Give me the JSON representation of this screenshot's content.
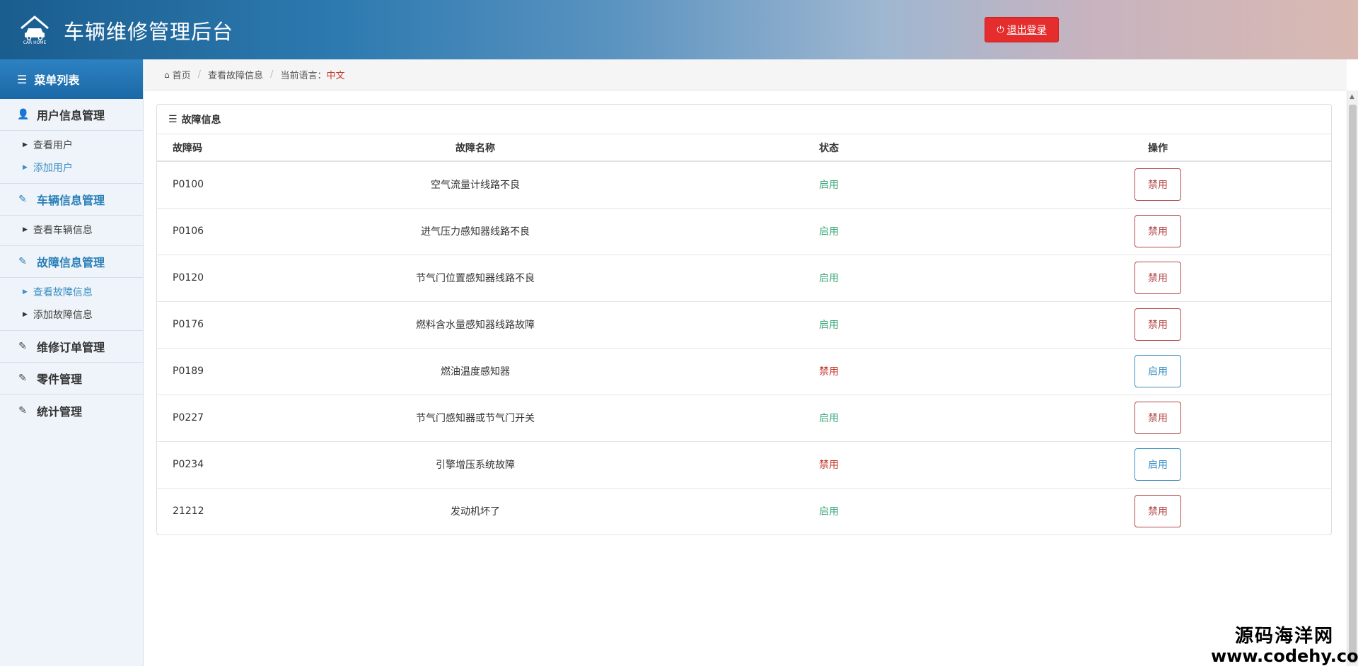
{
  "header": {
    "app_title": "车辆维修管理后台",
    "logout_label": "退出登录",
    "logo_icon": "car-home-icon",
    "logo_text": "CAR HOME"
  },
  "sidebar": {
    "menu_title": "菜单列表",
    "groups": [
      {
        "title": "用户信息管理",
        "icon": "user-icon",
        "items": [
          "查看用户",
          "添加用户"
        ]
      },
      {
        "title": "车辆信息管理",
        "icon": "edit-icon",
        "items": [
          "查看车辆信息"
        ]
      },
      {
        "title": "故障信息管理",
        "icon": "edit-icon",
        "items": [
          "查看故障信息",
          "添加故障信息"
        ]
      },
      {
        "title": "维修订单管理",
        "icon": "edit-icon",
        "items": []
      },
      {
        "title": "零件管理",
        "icon": "edit-icon",
        "items": []
      },
      {
        "title": "统计管理",
        "icon": "edit-icon",
        "items": []
      }
    ]
  },
  "breadcrumb": {
    "home": "首页",
    "current": "查看故障信息",
    "lang_label": "当前语言：",
    "lang_value": "中文"
  },
  "panel": {
    "title": "故障信息",
    "columns": [
      "故障码",
      "故障名称",
      "状态",
      "操作"
    ],
    "rows": [
      {
        "code": "P0100",
        "name": "空气流量计线路不良",
        "status": "启用",
        "action": "禁用"
      },
      {
        "code": "P0106",
        "name": "进气压力感知器线路不良",
        "status": "启用",
        "action": "禁用"
      },
      {
        "code": "P0120",
        "name": "节气门位置感知器线路不良",
        "status": "启用",
        "action": "禁用"
      },
      {
        "code": "P0176",
        "name": "燃料含水量感知器线路故障",
        "status": "启用",
        "action": "禁用"
      },
      {
        "code": "P0189",
        "name": "燃油温度感知器",
        "status": "禁用",
        "action": "启用"
      },
      {
        "code": "P0227",
        "name": "节气门感知器或节气门开关",
        "status": "启用",
        "action": "禁用"
      },
      {
        "code": "P0234",
        "name": "引擎增压系统故障",
        "status": "禁用",
        "action": "启用"
      },
      {
        "code": "21212",
        "name": "发动机坏了",
        "status": "启用",
        "action": "禁用"
      }
    ]
  },
  "watermark": {
    "line1": "源码海洋网",
    "line2": "www.codehy.com"
  },
  "colors": {
    "status_enabled": "#3aa87a",
    "status_disabled": "#c0392b",
    "logout_bg": "#e52d2d",
    "accent": "#2a7fb8"
  }
}
